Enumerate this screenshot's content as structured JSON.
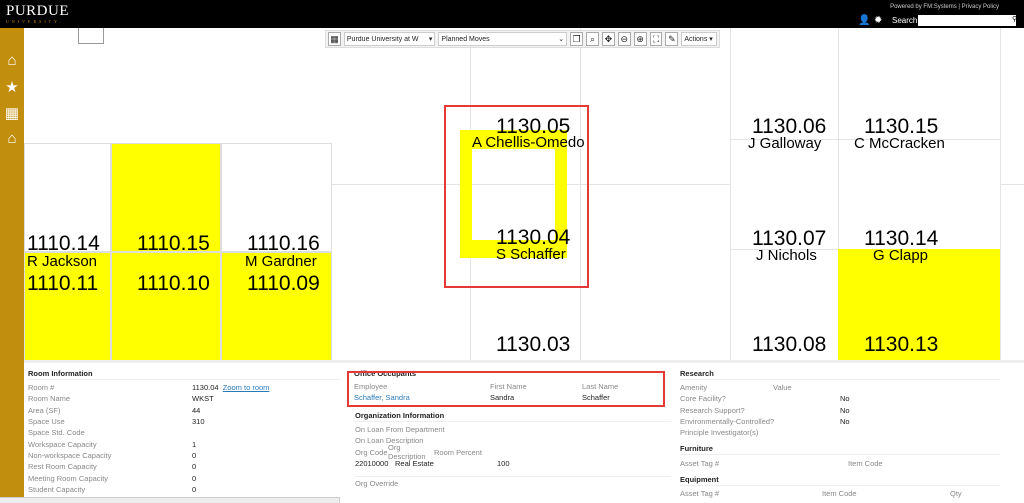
{
  "header": {
    "logo": "PURDUE",
    "logo_sub": "UNIVERSITY.",
    "powered": "Powered by FM:Systems | Privacy Policy",
    "search_label": "Search",
    "search_value": ""
  },
  "sidebar": {
    "items": [
      {
        "icon": "home-icon",
        "glyph": "⌂"
      },
      {
        "icon": "star-icon",
        "glyph": "★"
      },
      {
        "icon": "floorplan-icon",
        "glyph": "▦"
      },
      {
        "icon": "building-icon",
        "glyph": "⌂"
      }
    ]
  },
  "toolbar": {
    "site": "Purdue University at W",
    "layer": "Planned Moves",
    "actions": "Actions"
  },
  "rooms": {
    "r111014": "1110.14",
    "r111015": "1110.15",
    "r111016": "1110.16",
    "r111011": "1110.11",
    "r111010": "1110.10",
    "r111009": "1110.09",
    "jackson": "R Jackson",
    "gardner": "M Gardner",
    "r113005": "1130.05",
    "r113004": "1130.04",
    "r113003": "1130.03",
    "chellis": "A Chellis-Omedo",
    "schaffer": "S Schaffer",
    "r113006": "1130.06",
    "r113015": "1130.15",
    "galloway": "J Galloway",
    "mccracken": "C McCracken",
    "r113007": "1130.07",
    "r113014": "1130.14",
    "nichols": "J Nichols",
    "clapp": "G Clapp",
    "r113008": "1130.08",
    "r113013": "1130.13"
  },
  "colors": {
    "highlight": "#ffff00",
    "selection": "#e53935",
    "brand": "#c28e0e"
  },
  "room_info": {
    "title": "Room Information",
    "zoom_link": "Zoom to room",
    "rows": [
      {
        "label": "Room #",
        "value": "1130.04"
      },
      {
        "label": "Room Name",
        "value": "WKST"
      },
      {
        "label": "Area (SF)",
        "value": "44"
      },
      {
        "label": "Space Use",
        "value": "310"
      },
      {
        "label": "Space Std. Code",
        "value": ""
      },
      {
        "label": "Workspace Capacity",
        "value": "1"
      },
      {
        "label": "Non-workspace Capacity",
        "value": "0"
      },
      {
        "label": "Rest Room Capacity",
        "value": "0"
      },
      {
        "label": "Meeting Room Capacity",
        "value": "0"
      },
      {
        "label": "Student Capacity",
        "value": "0"
      }
    ]
  },
  "occupants": {
    "title": "Office Occupants",
    "headers": [
      "Employee",
      "First Name",
      "Last Name"
    ],
    "rows": [
      [
        "Schaffer, Sandra",
        "Sandra",
        "Schaffer"
      ]
    ]
  },
  "org": {
    "title": "Organization Information",
    "loan_from": "On Loan From Department",
    "loan_desc": "On Loan Description",
    "headers": [
      "Org Code",
      "Org Description",
      "Room Percent"
    ],
    "rows": [
      [
        "22010000",
        "Real Estate",
        "100"
      ]
    ],
    "override": "Org Override"
  },
  "research": {
    "title": "Research",
    "headers": [
      "Amenity",
      "Value"
    ],
    "rows": [
      [
        "Core Facility?",
        "No"
      ],
      [
        "Research Support?",
        "No"
      ],
      [
        "Environmentally-Controlled?",
        "No"
      ],
      [
        "Principle Investigator(s)",
        ""
      ]
    ]
  },
  "furniture": {
    "title": "Furniture",
    "headers": [
      "Asset Tag #",
      "Item Code"
    ]
  },
  "equipment": {
    "title": "Equipment",
    "headers": [
      "Asset Tag #",
      "Item Code",
      "Qty"
    ]
  }
}
